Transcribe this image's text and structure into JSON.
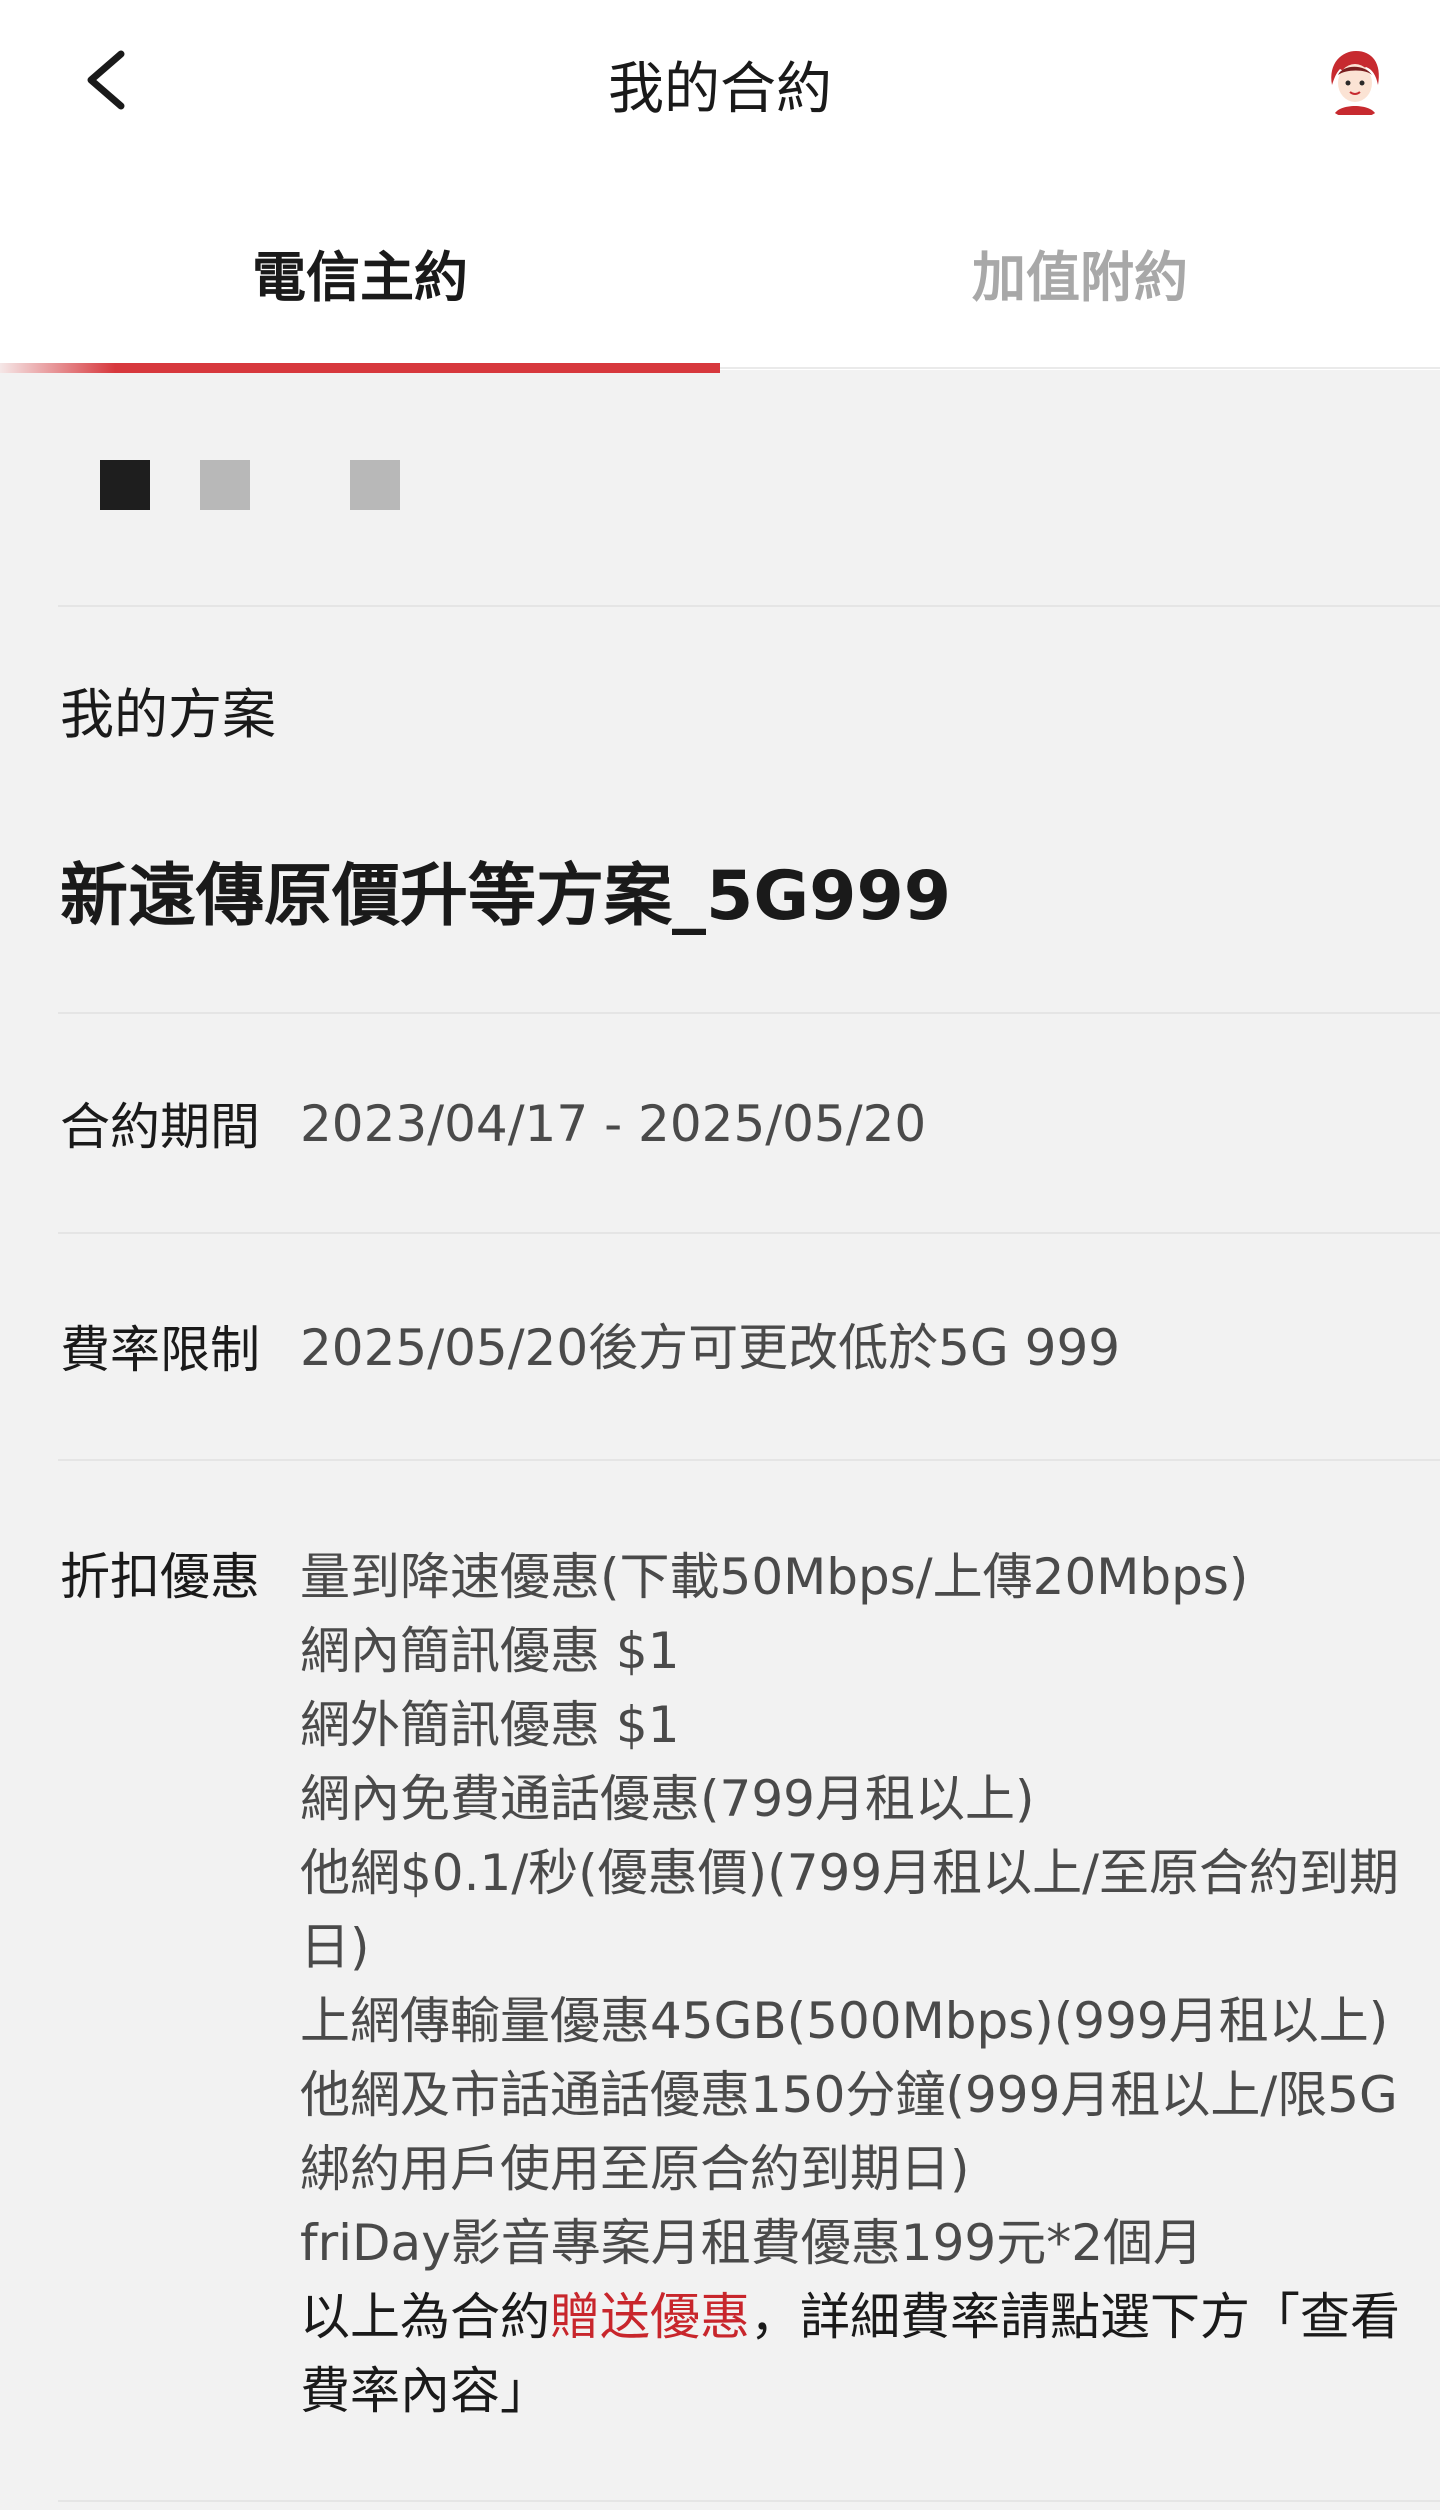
{
  "header": {
    "title": "我的合約",
    "back_icon": "chevron-left-icon",
    "avatar_icon": "avatar-icon"
  },
  "tabs": [
    {
      "label": "電信主約",
      "active": true
    },
    {
      "label": "加值附約",
      "active": false
    }
  ],
  "colors": {
    "accent": "#d7383d",
    "gift_text": "#c8262c",
    "tab_inactive": "#a8a8a8",
    "background": "#f2f2f2"
  },
  "plan": {
    "label": "我的方案",
    "name": "新遠傳原價升等方案_5G999"
  },
  "contract_period": {
    "label": "合約期間",
    "value": "2023/04/17 - 2025/05/20"
  },
  "rate_limit": {
    "label": "費率限制",
    "value": "2025/05/20後方可更改低於5G 999"
  },
  "discounts": {
    "label": "折扣優惠",
    "items": [
      "量到降速優惠(下載50Mbps/上傳20Mbps)",
      "網內簡訊優惠 $1",
      "網外簡訊優惠 $1",
      "網內免費通話優惠(799月租以上)",
      "他網$0.1/秒(優惠價)(799月租以上/至原合約到期日)",
      "上網傳輸量優惠45GB(500Mbps)(999月租以上)",
      "他網及市話通話優惠150分鐘(999月租以上/限5G綁約用戶使用至原合約到期日)",
      "friDay影音專案月租費優惠199元*2個月"
    ],
    "gift_prefix": "以上為合約",
    "gift_highlight": "贈送優惠",
    "gift_suffix": "，詳細費率請點選下方「查看費率內容」"
  }
}
